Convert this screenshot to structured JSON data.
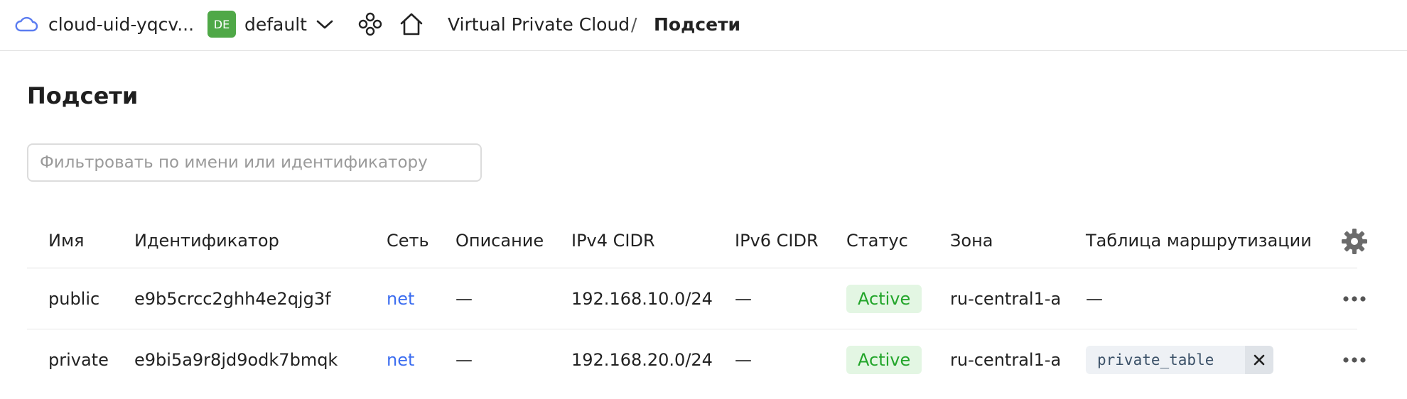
{
  "header": {
    "cloud_name": "cloud-uid-yqcv...",
    "folder_badge": "DE",
    "folder_name": "default",
    "breadcrumb": [
      "Virtual Private Cloud",
      "/",
      "Подсети"
    ]
  },
  "page": {
    "title": "Подсети",
    "filter_placeholder": "Фильтровать по имени или идентификатору",
    "filter_value": ""
  },
  "table": {
    "columns": [
      "Имя",
      "Идентификатор",
      "Сеть",
      "Описание",
      "IPv4 CIDR",
      "IPv6 CIDR",
      "Статус",
      "Зона",
      "Таблица маршрутизации"
    ],
    "rows": [
      {
        "name": "public",
        "id": "e9b5crcc2ghh4e2qjg3f",
        "network": "net",
        "description": "—",
        "ipv4": "192.168.10.0/24",
        "ipv6": "—",
        "status": "Active",
        "zone": "ru-central1-a",
        "route_table": "—"
      },
      {
        "name": "private",
        "id": "e9bi5a9r8jd9odk7bmqk",
        "network": "net",
        "description": "—",
        "ipv4": "192.168.20.0/24",
        "ipv6": "—",
        "status": "Active",
        "zone": "ru-central1-a",
        "route_table": "private_table"
      }
    ]
  },
  "icons": {
    "cloud": "cloud-icon",
    "chevron": "chevron-down-icon",
    "services": "services-icon",
    "home": "home-icon",
    "settings": "gear-icon",
    "more": "more-icon",
    "remove": "close-icon"
  },
  "colors": {
    "accent_link": "#3d6ef0",
    "status_active_text": "#22a52a",
    "status_active_bg": "#e3f6e3",
    "folder_badge_bg": "#4fa847"
  }
}
